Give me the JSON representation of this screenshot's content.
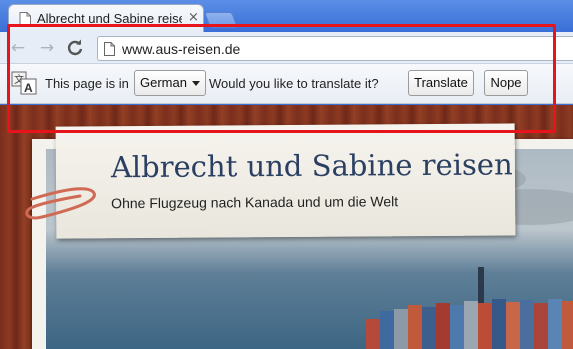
{
  "tab": {
    "title": "Albrecht und Sabine reisen |",
    "close_glyph": "×"
  },
  "toolbar": {
    "back_glyph": "←",
    "forward_glyph": "→",
    "reload_glyph": "C",
    "url": "www.aus-reisen.de"
  },
  "infobar": {
    "prefix_text": "This page is in",
    "language": "German",
    "question_text": "Would you like to translate it?",
    "translate_label": "Translate",
    "nope_label": "Nope"
  },
  "page": {
    "title": "Albrecht und Sabine reisen",
    "subtitle": "Ohne Flugzeug nach Kanada und um die Welt"
  },
  "colors": {
    "highlight": "#e8141c",
    "chrome_blue": "#3a6fd8",
    "title_blue": "#2b3f63"
  },
  "icons": [
    "page-icon",
    "translate-icon",
    "back-arrow-icon",
    "forward-arrow-icon",
    "reload-icon",
    "close-icon",
    "dropdown-caret-icon",
    "paperclip-icon"
  ]
}
